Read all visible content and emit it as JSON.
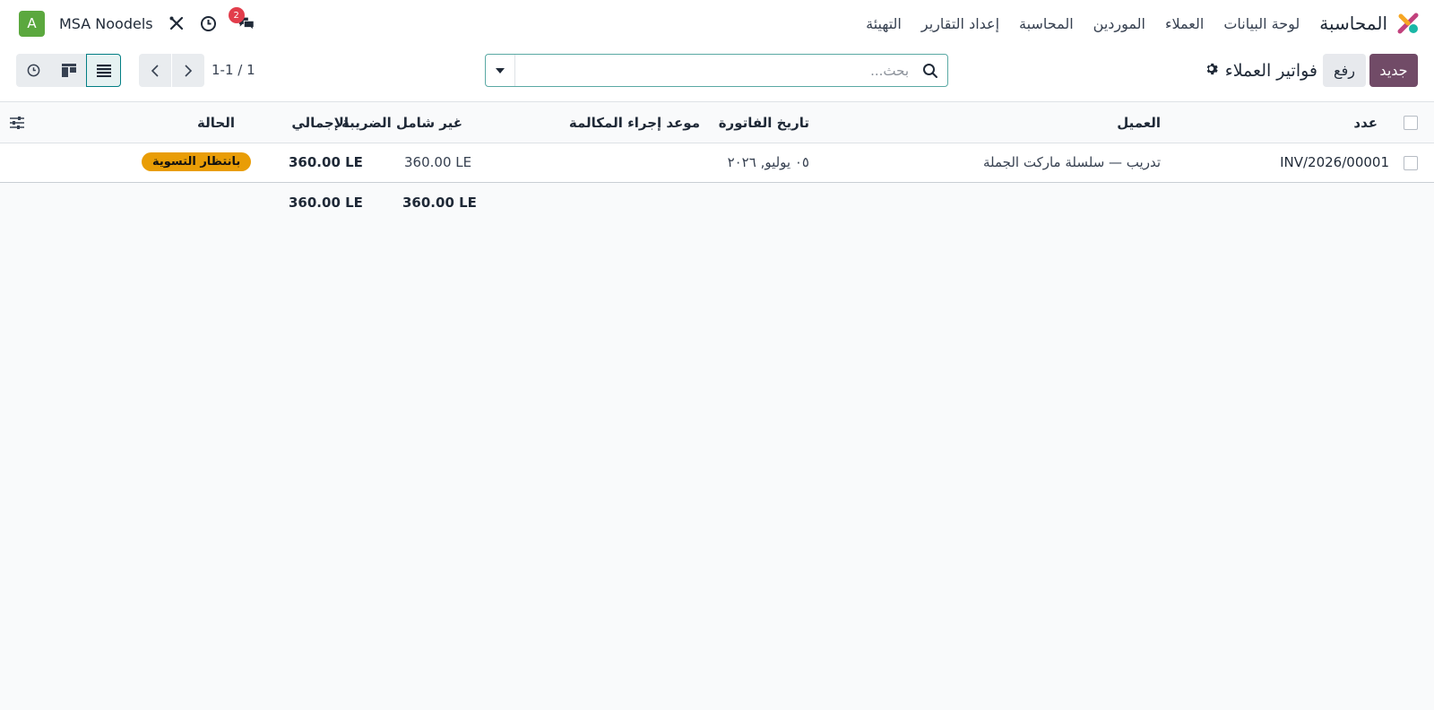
{
  "navbar": {
    "app_name": "المحاسبة",
    "menu": [
      "لوحة البيانات",
      "العملاء",
      "الموردين",
      "المحاسبة",
      "إعداد التقارير",
      "التهيئة"
    ],
    "company": "MSA Noodels",
    "avatar_letter": "A",
    "messages_count": "2"
  },
  "control": {
    "new_label": "جديد",
    "upload_label": "رفع",
    "title": "فواتير العملاء",
    "search_placeholder": "بحث...",
    "pager": "1-1 / 1"
  },
  "table": {
    "columns": {
      "number": "عدد",
      "customer": "العميل",
      "invoice_date": "تاريخ الفاتورة",
      "next_activity": "موعد إجراء المكالمة",
      "untaxed": "غير شامل الضريبة",
      "total": "الإجمالي",
      "status": "الحالة"
    },
    "rows": [
      {
        "number": "INV/2026/00001",
        "customer": "تدريب — سلسلة ماركت الجملة",
        "invoice_date": "٠٥ يوليو, ٢٠٢٦",
        "next_activity": "",
        "untaxed": "360.00 LE",
        "total": "360.00 LE",
        "status": "بانتظار التسوية"
      }
    ],
    "totals": {
      "untaxed": "360.00 LE",
      "total": "360.00 LE"
    }
  },
  "colors": {
    "primary": "#714b67",
    "accent": "#017e84",
    "status_badge": "#e99d06",
    "avatar": "#5ba83e",
    "badge": "#e23d4b"
  },
  "icons": [
    "app-logo-icon",
    "search-icon",
    "dropdown-caret-icon",
    "chevron-left-icon",
    "chevron-right-icon",
    "list-view-icon",
    "kanban-view-icon",
    "activity-view-icon",
    "settings-gear-icon",
    "optional-columns-icon",
    "chat-icon",
    "clock-icon",
    "tools-icon"
  ]
}
